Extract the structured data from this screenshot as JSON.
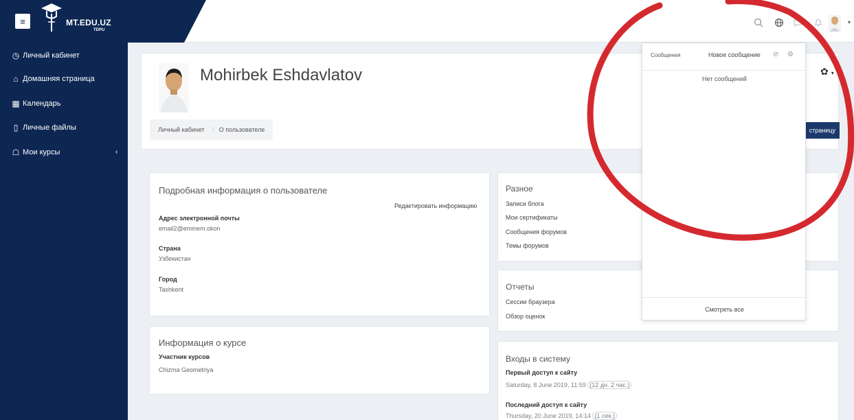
{
  "brand": {
    "name": "MT.EDU.UZ",
    "sub": "TDPU",
    "menu_icon": "hamburger-icon"
  },
  "topbar": {
    "icons": [
      "search-icon",
      "globe-icon",
      "chat-icon",
      "bell-icon"
    ]
  },
  "sidebar": {
    "items": [
      {
        "label": "Личный кабинет",
        "icon": "dashboard-icon"
      },
      {
        "label": "Домашняя страница",
        "icon": "home-icon"
      },
      {
        "label": "Календарь",
        "icon": "calendar-icon"
      },
      {
        "label": "Личные файлы",
        "icon": "file-icon"
      },
      {
        "label": "Мои курсы",
        "icon": "graduation-cap-icon"
      }
    ]
  },
  "header": {
    "name": "Mohirbek Eshdavlatov",
    "breadcrumb": [
      "Личный кабинет",
      "О пользователе"
    ],
    "reset_button": "страницу"
  },
  "details": {
    "title": "Подробная информация о пользователе",
    "edit_link": "Редактировать информацию",
    "email_label": "Адрес электронной почты",
    "email_value": "email2@eminem.okon",
    "country_label": "Страна",
    "country_value": "Узбекистан",
    "city_label": "Город",
    "city_value": "Tashkent"
  },
  "course": {
    "title": "Информация о курсе",
    "label": "Участник курсов",
    "value": "Chizma Geometriya"
  },
  "misc": {
    "title": "Разное",
    "links": [
      "Записи блога",
      "Мои сертификаты",
      "Сообщения форумов",
      "Темы форумов"
    ]
  },
  "reports": {
    "title": "Отчеты",
    "links": [
      "Сессии браузера",
      "Обзор оценок"
    ]
  },
  "logins": {
    "title": "Входы в систему",
    "first_label": "Первый доступ к сайту",
    "first_value": "Saturday, 8 June 2019, 11:59",
    "first_ago": "(12 дн. 2 час.)",
    "last_label": "Последний доступ к сайту",
    "last_value": "Thursday, 20 June 2019, 14:14",
    "last_ago": "(1 сек.)"
  },
  "messages": {
    "title": "Сообщения",
    "new_message": "Новое сообщение",
    "empty": "Нет сообщений",
    "view_all": "Смотреть все"
  },
  "colors": {
    "navy": "#0d2752",
    "annotation": "#d42a2f"
  }
}
